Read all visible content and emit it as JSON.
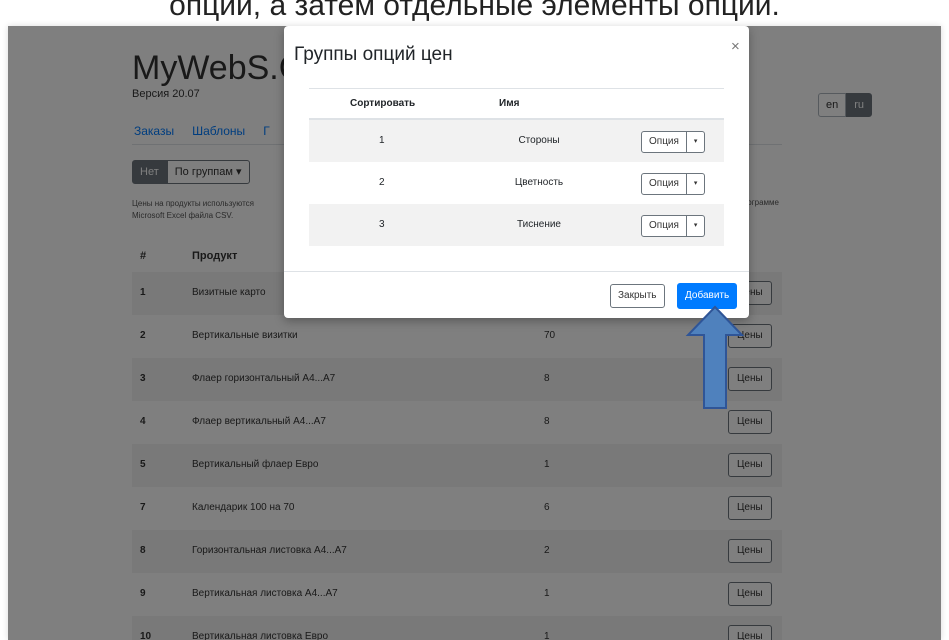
{
  "caption": "опции, а затем отдельные элементы опции.",
  "app": {
    "brand": "MyWebS.Ca",
    "version": "Версия 20.07",
    "lang": [
      "en",
      "ru"
    ],
    "nav": [
      "Заказы",
      "Шаблоны",
      "Г"
    ]
  },
  "filter": {
    "no": "Нет",
    "groups": "По группам ▾"
  },
  "note": {
    "left": "Цены на продукты используются\nMicrosoft Excel файла CSV.",
    "right": "в программе"
  },
  "table": {
    "headers": {
      "num": "#",
      "product": "Продукт"
    },
    "button_label": "Цены",
    "rows": [
      {
        "num": "1",
        "product": "Визитные карто",
        "qty": ""
      },
      {
        "num": "2",
        "product": "Вертикальные визитки",
        "qty": "70"
      },
      {
        "num": "3",
        "product": "Флаер горизонтальный А4...А7",
        "qty": "8"
      },
      {
        "num": "4",
        "product": "Флаер вертикальный А4...А7",
        "qty": "8"
      },
      {
        "num": "5",
        "product": "Вертикальный флаер Евро",
        "qty": "1"
      },
      {
        "num": "7",
        "product": "Календарик 100 на 70",
        "qty": "6"
      },
      {
        "num": "8",
        "product": "Горизонтальная листовка А4...А7",
        "qty": "2"
      },
      {
        "num": "9",
        "product": "Вертикальная листовка А4...А7",
        "qty": "1"
      },
      {
        "num": "10",
        "product": "Вертикальная листовка Евро",
        "qty": "1"
      }
    ]
  },
  "modal": {
    "title": "Группы опций цен",
    "close": "×",
    "headers": {
      "sort": "Сортировать",
      "name": "Имя"
    },
    "rows": [
      {
        "sort": "1",
        "name": "Стороны",
        "option": "Опция",
        "caret": "▾"
      },
      {
        "sort": "2",
        "name": "Цветность",
        "option": "Опция",
        "caret": "▾"
      },
      {
        "sort": "3",
        "name": "Тиснение",
        "option": "Опция",
        "caret": "▾"
      }
    ],
    "close_button": "Закрыть",
    "add_button": "Добавить"
  },
  "colors": {
    "primary": "#007bff",
    "secondary": "#6c757d",
    "arrow_fill": "#4f81bd",
    "arrow_stroke": "#2f5597"
  },
  "icons": {
    "close": "close-icon",
    "caret": "caret-down-icon",
    "arrow": "up-arrow-annotation"
  }
}
